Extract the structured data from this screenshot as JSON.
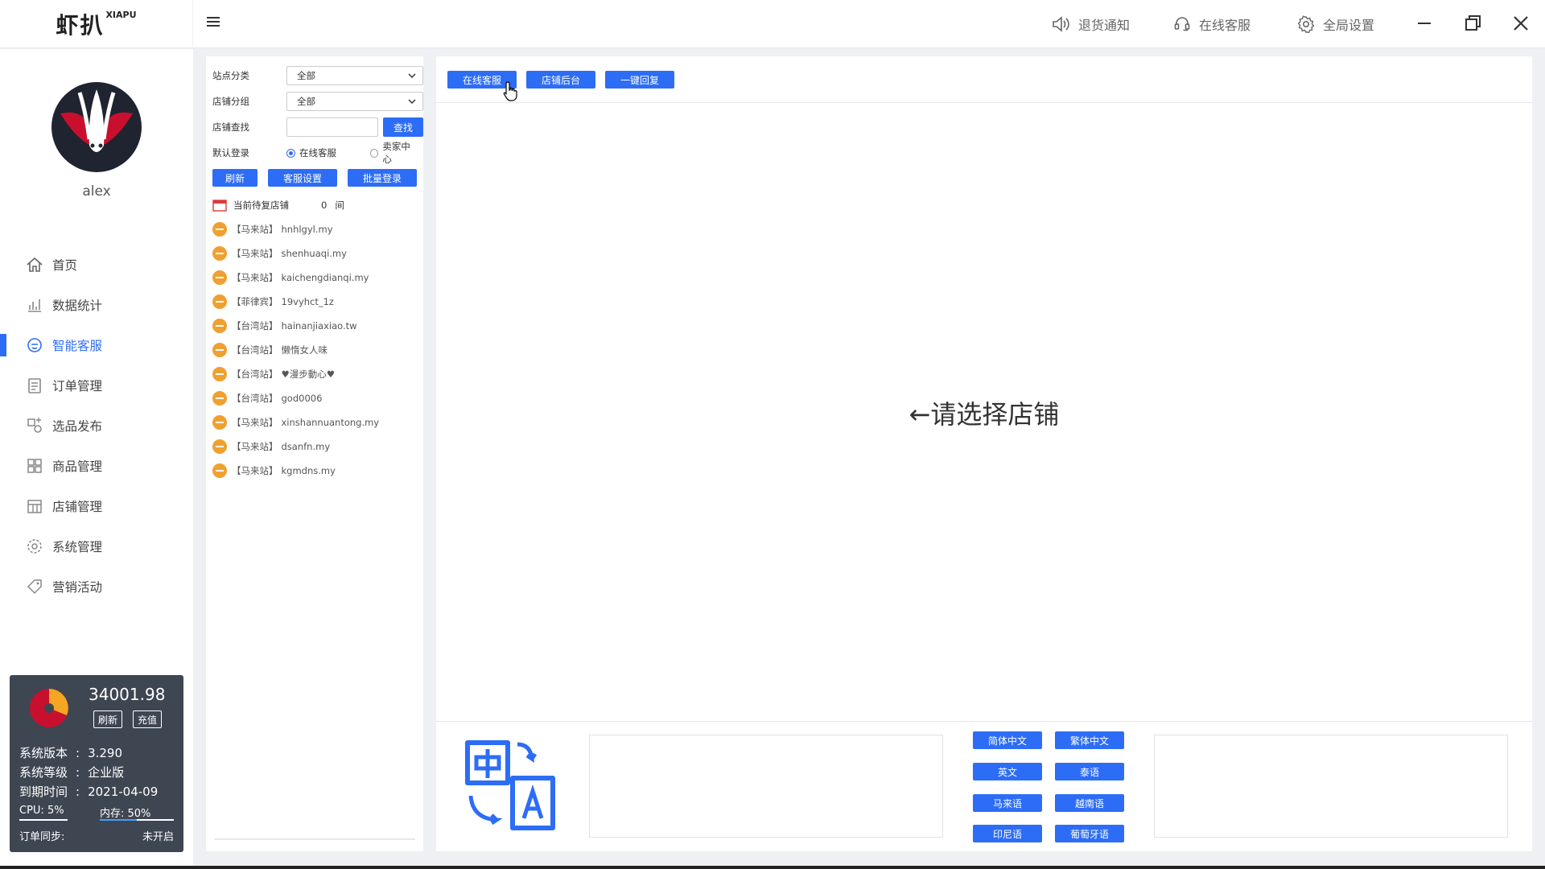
{
  "app": {
    "logo": "虾扒",
    "logo_sup": "XIAPU"
  },
  "titlebar": {
    "return_notice": "退货通知",
    "online_service": "在线客服",
    "global_settings": "全局设置"
  },
  "user": {
    "name": "alex"
  },
  "nav": {
    "home": "首页",
    "stats": "数据统计",
    "smart_service": "智能客服",
    "orders": "订单管理",
    "publish": "选品发布",
    "products": "商品管理",
    "stores": "店铺管理",
    "system": "系统管理",
    "marketing": "营销活动",
    "active": "smart_service"
  },
  "card": {
    "balance": "34001.98",
    "refresh": "刷新",
    "recharge": "充值",
    "version_label": "系统版本",
    "version_value": "3.290",
    "level_label": "系统等级",
    "level_value": "企业版",
    "expire_label": "到期时间",
    "expire_value": "2021-04-09",
    "cpu": "CPU: 5%",
    "mem": "内存: 50%",
    "mem_percent": 50,
    "sync_label": "订单同步:",
    "sync_value": "未开启",
    "pie_colors": [
      "#c8102e",
      "#f5a623"
    ]
  },
  "panel": {
    "site_label": "站点分类",
    "site_value": "全部",
    "group_label": "店铺分组",
    "group_value": "全部",
    "find_label": "店铺查找",
    "find_placeholder": "",
    "find_button": "查找",
    "login_label": "默认登录",
    "login_option_1": "在线客服",
    "login_option_2": "卖家中心",
    "refresh_btn": "刷新",
    "service_settings_btn": "客服设置",
    "batch_login_btn": "批量登录",
    "pending_label": "当前待复店铺",
    "pending_count": "0",
    "pending_unit": "间",
    "shops": [
      {
        "region": "【马来站】",
        "name": "hnhlgyl.my"
      },
      {
        "region": "【马来站】",
        "name": "shenhuaqi.my"
      },
      {
        "region": "【马来站】",
        "name": "kaichengdianqi.my"
      },
      {
        "region": "【菲律宾】",
        "name": "19vyhct_1z"
      },
      {
        "region": "【台湾站】",
        "name": "hainanjiaxiao.tw"
      },
      {
        "region": "【台湾站】",
        "name": "懒惰女人味"
      },
      {
        "region": "【台湾站】",
        "name": "♥漫步動心♥"
      },
      {
        "region": "【台湾站】",
        "name": "god0006"
      },
      {
        "region": "【马来站】",
        "name": "xinshannuantong.my"
      },
      {
        "region": "【马来站】",
        "name": "dsanfn.my"
      },
      {
        "region": "【马来站】",
        "name": "kgmdns.my"
      }
    ]
  },
  "main": {
    "btn_online": "在线客服",
    "btn_backend": "店铺后台",
    "btn_reply": "一键回复",
    "placeholder": "←请选择店铺"
  },
  "translate": {
    "simplified": "简体中文",
    "traditional": "繁体中文",
    "english": "英文",
    "thai": "泰语",
    "malay": "马来语",
    "vietnamese": "越南语",
    "indonesian": "印尼语",
    "portuguese": "葡萄牙语"
  },
  "colors": {
    "accent": "#2d6df6",
    "status_dot": "#f0a030",
    "card_bg": "#3e4652"
  }
}
